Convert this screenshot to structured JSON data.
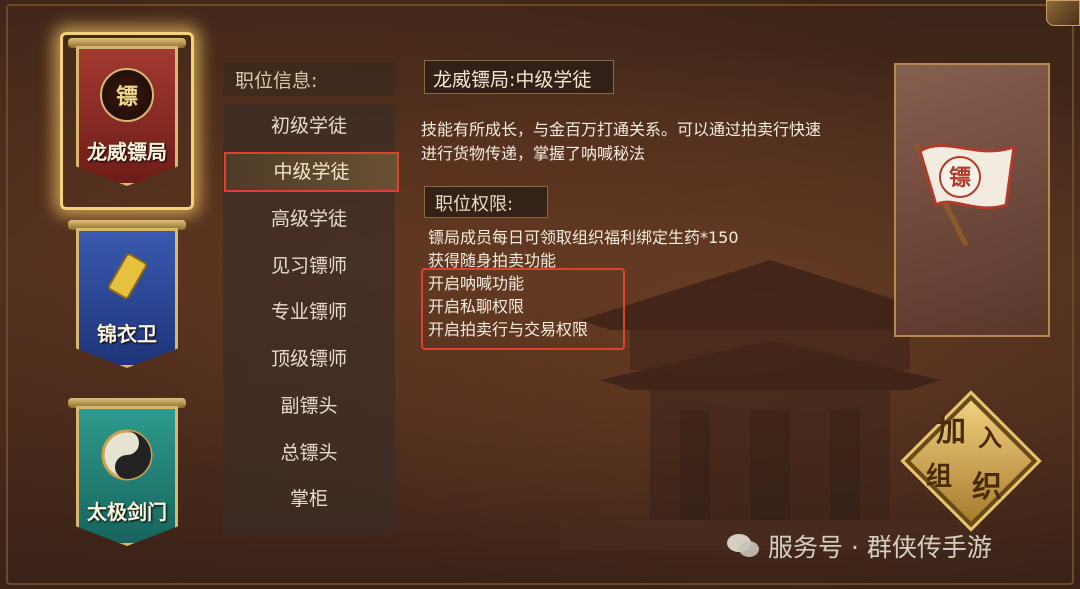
{
  "banners": [
    {
      "label": "龙威镖局",
      "emblem": "镖",
      "color": "#8e2a24",
      "selected": true
    },
    {
      "label": "锦衣卫",
      "emblem": "",
      "color": "#2c4a9a",
      "selected": false
    },
    {
      "label": "太极剑门",
      "emblem": "",
      "color": "#2a8a80",
      "selected": false
    }
  ],
  "rank_list": {
    "header": "职位信息:",
    "items": [
      "初级学徒",
      "中级学徒",
      "高级学徒",
      "见习镖师",
      "专业镖师",
      "顶级镖师",
      "副镖头",
      "总镖头",
      "掌柜"
    ],
    "selected_index": 1
  },
  "detail": {
    "title": "龙威镖局:中级学徒",
    "description_line1": "技能有所成长，与金百万打通关系。可以通过拍卖行快速",
    "description_line2": "进行货物传递，掌握了呐喊秘法",
    "permissions_title": "职位权限:",
    "permissions": [
      "镖局成员每日可领取组织福利绑定生药*150",
      "获得随身拍卖功能",
      "开启呐喊功能",
      "开启私聊权限",
      "开启拍卖行与交易权限"
    ]
  },
  "preview": {
    "flag_char": "镖"
  },
  "join_button": {
    "chars": [
      "加",
      "入",
      "组",
      "织"
    ]
  },
  "watermark": {
    "text": "服务号 · 群侠传手游"
  },
  "colors": {
    "highlight_red": "#e0402f",
    "gold": "#d8b770"
  }
}
